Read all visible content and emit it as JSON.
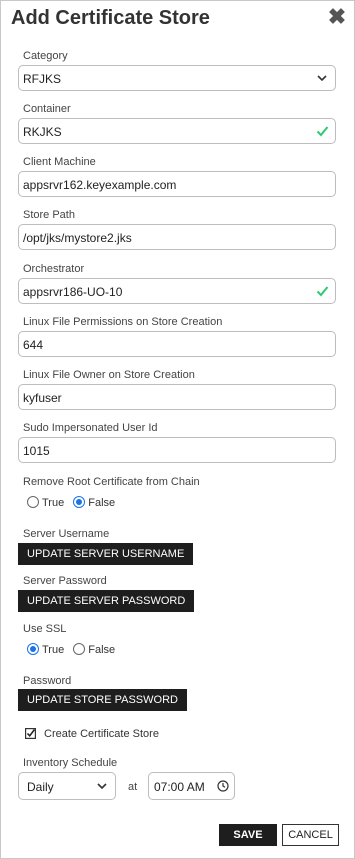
{
  "dialog": {
    "title": "Add Certificate Store",
    "close_glyph": "✖"
  },
  "fields": {
    "category": {
      "label": "Category",
      "value": "RFJKS"
    },
    "container": {
      "label": "Container",
      "value": "RKJKS"
    },
    "client_machine": {
      "label": "Client Machine",
      "value": "appsrvr162.keyexample.com"
    },
    "store_path": {
      "label": "Store Path",
      "value": "/opt/jks/mystore2.jks"
    },
    "orchestrator": {
      "label": "Orchestrator",
      "value": "appsrvr186-UO-10"
    },
    "linux_permissions": {
      "label": "Linux File Permissions on Store Creation",
      "value": "644"
    },
    "linux_owner": {
      "label": "Linux File Owner on Store Creation",
      "value": "kyfuser"
    },
    "sudo_user": {
      "label": "Sudo Impersonated User Id",
      "value": "1015"
    }
  },
  "remove_root": {
    "label": "Remove Root Certificate from Chain",
    "options": [
      {
        "label": "True",
        "selected": false
      },
      {
        "label": "False",
        "selected": true
      }
    ]
  },
  "server_username": {
    "label": "Server Username",
    "button": "UPDATE SERVER USERNAME"
  },
  "server_password": {
    "label": "Server Password",
    "button": "UPDATE SERVER PASSWORD"
  },
  "use_ssl": {
    "label": "Use SSL",
    "options": [
      {
        "label": "True",
        "selected": true
      },
      {
        "label": "False",
        "selected": false
      }
    ]
  },
  "password": {
    "label": "Password",
    "button": "UPDATE STORE PASSWORD"
  },
  "create_store": {
    "label": "Create Certificate Store",
    "checked": true
  },
  "schedule": {
    "label": "Inventory Schedule",
    "value": "Daily",
    "at_label": "at",
    "time": "07:00 AM"
  },
  "actions": {
    "save": "SAVE",
    "cancel": "CANCEL"
  },
  "colors": {
    "accent": "#1a73e8",
    "valid_check": "#2ecc71",
    "dark_button": "#1e1e1e"
  },
  "icons": {
    "close": "close-icon",
    "dropdown": "chevron-down-icon",
    "valid": "checkmark-icon",
    "checkbox": "checkbox-checked-icon",
    "clock": "clock-icon"
  }
}
